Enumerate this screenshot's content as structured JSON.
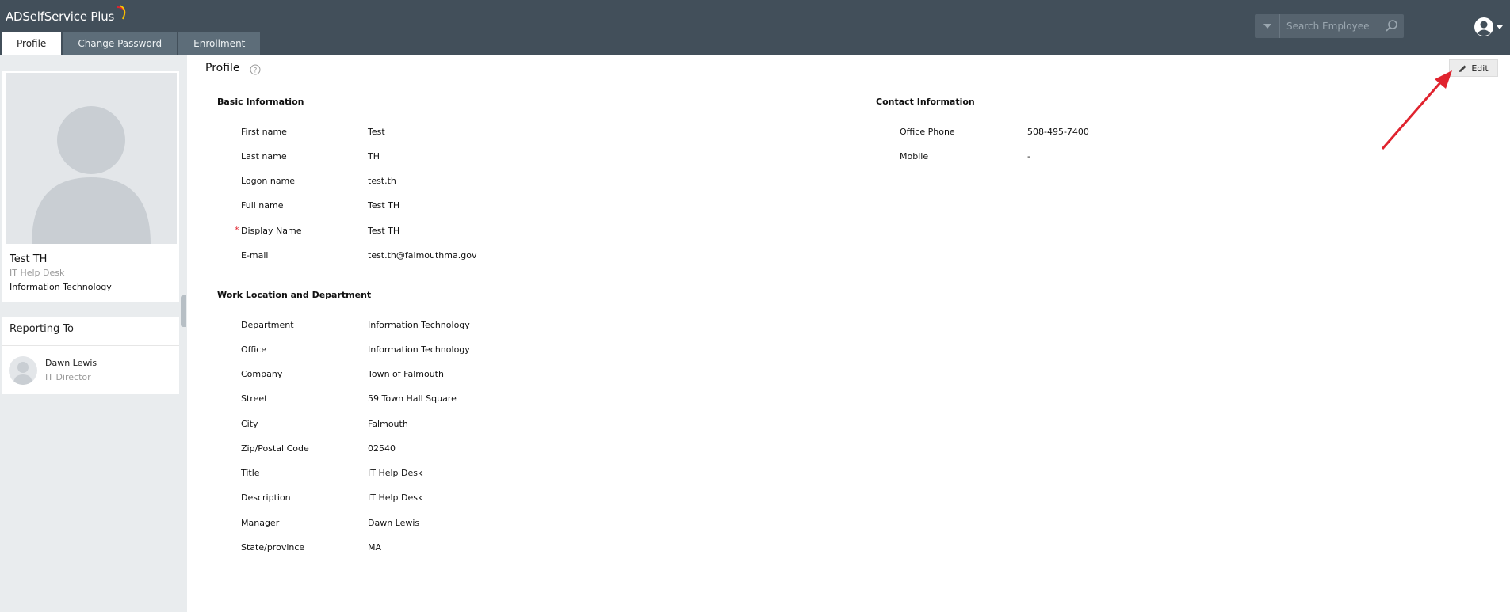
{
  "app": {
    "title": "ADSelfService Plus"
  },
  "header": {
    "tabs": [
      {
        "label": "Profile",
        "active": true
      },
      {
        "label": "Change Password",
        "active": false
      },
      {
        "label": "Enrollment",
        "active": false
      }
    ],
    "search": {
      "placeholder": "Search Employee"
    },
    "icons": {
      "search": "search-icon",
      "user": "user-account-icon",
      "dropdown": "chevron-down-icon"
    }
  },
  "profile_card": {
    "name": "Test TH",
    "title": "IT Help Desk",
    "department": "Information Technology"
  },
  "reporting": {
    "heading": "Reporting To",
    "manager_name": "Dawn Lewis",
    "manager_title": "IT Director"
  },
  "main": {
    "title": "Profile",
    "edit_label": "Edit",
    "basic": {
      "heading": "Basic Information",
      "fields": [
        {
          "label": "First name",
          "value": "Test"
        },
        {
          "label": "Last name",
          "value": "TH"
        },
        {
          "label": "Logon name",
          "value": "test.th"
        },
        {
          "label": "Full name",
          "value": "Test TH"
        },
        {
          "label": "Display Name",
          "value": "Test TH",
          "required": true
        },
        {
          "label": "E-mail",
          "value": "test.th@falmouthma.gov"
        }
      ]
    },
    "contact": {
      "heading": "Contact Information",
      "fields": [
        {
          "label": "Office Phone",
          "value": "508-495-7400"
        },
        {
          "label": "Mobile",
          "value": "-"
        }
      ]
    },
    "work": {
      "heading": "Work Location and Department",
      "fields": [
        {
          "label": "Department",
          "value": "Information Technology"
        },
        {
          "label": "Office",
          "value": "Information Technology"
        },
        {
          "label": "Company",
          "value": "Town of Falmouth"
        },
        {
          "label": "Street",
          "value": "59 Town Hall Square"
        },
        {
          "label": "City",
          "value": "Falmouth"
        },
        {
          "label": "Zip/Postal Code",
          "value": "02540"
        },
        {
          "label": "Title",
          "value": "IT Help Desk"
        },
        {
          "label": "Description",
          "value": "IT Help Desk"
        },
        {
          "label": "Manager",
          "value": "Dawn Lewis"
        },
        {
          "label": "State/province",
          "value": "MA"
        }
      ]
    }
  },
  "colors": {
    "header": "#424f5a",
    "tab": "#5d6d79",
    "accent_arrow": "#e0232e"
  }
}
